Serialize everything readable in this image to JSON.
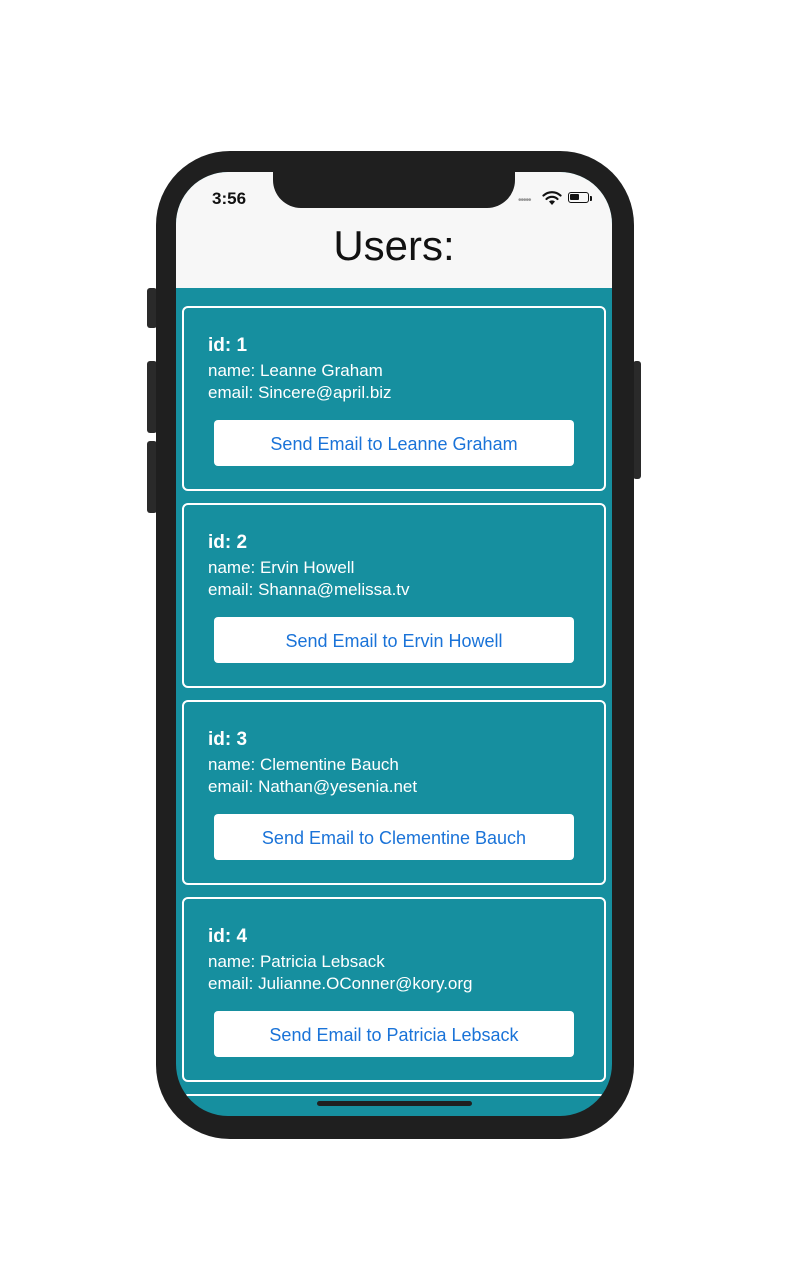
{
  "status_bar": {
    "time": "3:56"
  },
  "header": {
    "title": "Users:"
  },
  "users": [
    {
      "id": "id: 1",
      "name": "name: Leanne Graham",
      "email": "email: Sincere@april.biz",
      "button": "Send Email to Leanne Graham"
    },
    {
      "id": "id: 2",
      "name": "name: Ervin Howell",
      "email": "email: Shanna@melissa.tv",
      "button": "Send Email to Ervin Howell"
    },
    {
      "id": "id: 3",
      "name": "name: Clementine Bauch",
      "email": "email: Nathan@yesenia.net",
      "button": "Send Email to Clementine Bauch"
    },
    {
      "id": "id: 4",
      "name": "name: Patricia Lebsack",
      "email": "email: Julianne.OConner@kory.org",
      "button": "Send Email to Patricia Lebsack"
    }
  ],
  "icons": {
    "signal": "signal-dots-icon",
    "wifi": "wifi-icon",
    "battery": "battery-icon"
  },
  "colors": {
    "list_background": "#168f9f",
    "header_background": "#f7f7f7",
    "button_text": "#1a73d8"
  }
}
